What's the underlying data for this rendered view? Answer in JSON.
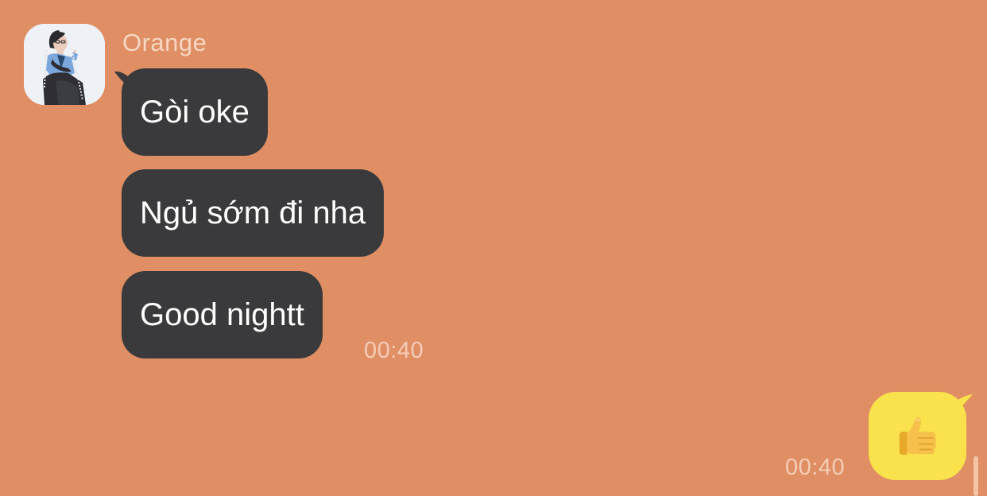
{
  "chat": {
    "sender": "Orange",
    "incoming_messages": [
      {
        "text": "Gòi oke"
      },
      {
        "text": "Ngủ sớm đi nha"
      },
      {
        "text": "Good nightt"
      }
    ],
    "incoming_time": "00:40",
    "outgoing_message": {
      "emoji": "thumbs-up-icon",
      "time": "00:40"
    }
  },
  "colors": {
    "background": "#E08E64",
    "incoming_bubble": "#3A3A3C",
    "outgoing_bubble": "#F9E24C",
    "meta_text": "#F5CDB7"
  }
}
